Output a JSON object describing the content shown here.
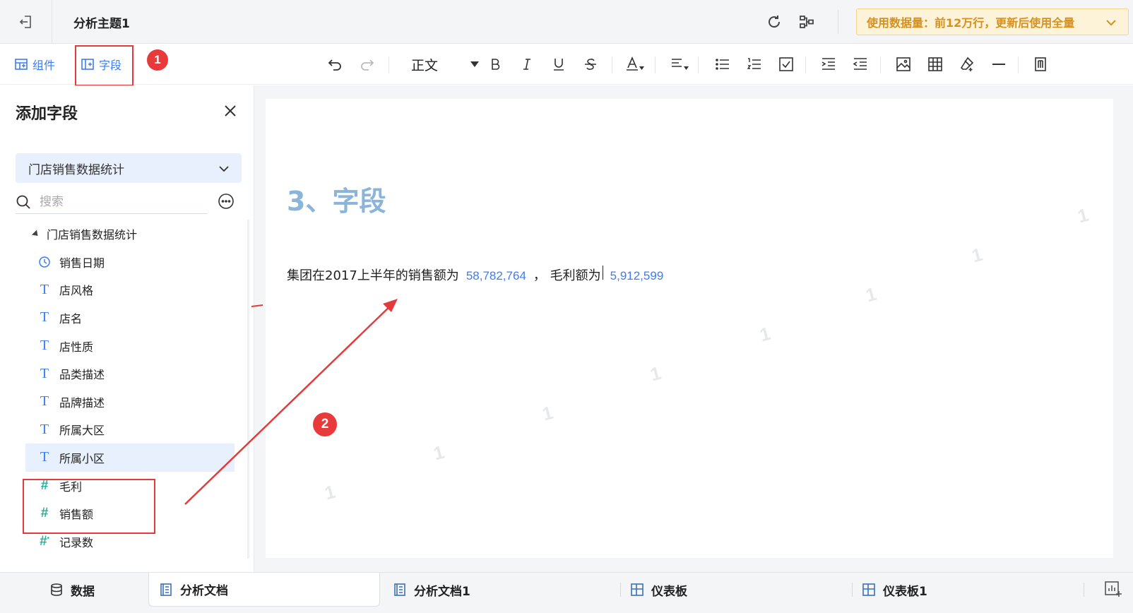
{
  "header": {
    "doc_title": "分析主题1",
    "data_banner": "使用数据量：前12万行，更新后使用全量"
  },
  "toolbar": {
    "tab_components": "组件",
    "tab_fields": "字段",
    "style_select": "正文",
    "badge_1": "1",
    "badge_2": "2"
  },
  "panel": {
    "title": "添加字段",
    "dataset": "门店销售数据统计",
    "search_placeholder": "搜索",
    "tree_root": "门店销售数据统计",
    "fields": [
      {
        "label": "销售日期",
        "type": "date"
      },
      {
        "label": "店风格",
        "type": "text"
      },
      {
        "label": "店名",
        "type": "text"
      },
      {
        "label": "店性质",
        "type": "text"
      },
      {
        "label": "品类描述",
        "type": "text"
      },
      {
        "label": "品牌描述",
        "type": "text"
      },
      {
        "label": "所属大区",
        "type": "text"
      },
      {
        "label": "所属小区",
        "type": "text",
        "selected": true
      },
      {
        "label": "毛利",
        "type": "number"
      },
      {
        "label": "销售额",
        "type": "number"
      },
      {
        "label": "记录数",
        "type": "count"
      }
    ]
  },
  "document": {
    "section_title": "3、字段",
    "para_prefix": "集团在2017上半年的销售额为",
    "sales_value": "58,782,764",
    "para_middle": "，  毛利额为",
    "profit_value": "5,912,599",
    "watermark": "1"
  },
  "bottom_tabs": {
    "data": "数据",
    "doc": "分析文档",
    "doc1": "分析文档1",
    "dashboard": "仪表板",
    "dashboard1": "仪表板1"
  },
  "colors": {
    "accent": "#3d7cf5",
    "annotation_red": "#e33b3b",
    "banner_text": "#d6901e",
    "number_field": "#20b39b",
    "title_blue": "#8ab4d8"
  }
}
